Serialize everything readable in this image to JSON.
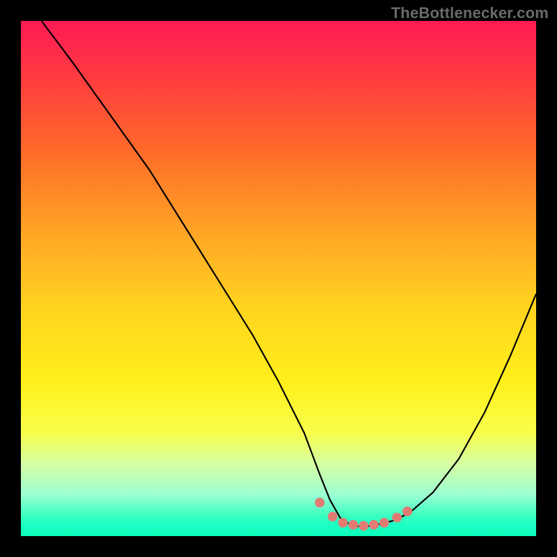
{
  "watermark": "TheBottlenecker.com",
  "colors": {
    "frame": "#000000",
    "curve_stroke": "#000000",
    "marker_fill": "#e27b74",
    "gradient_top": "#ff1a55",
    "gradient_bottom": "#0cffb9"
  },
  "chart_data": {
    "type": "line",
    "title": "",
    "xlabel": "",
    "ylabel": "",
    "xlim": [
      0,
      100
    ],
    "ylim": [
      0,
      100
    ],
    "grid": false,
    "legend": false,
    "series": [
      {
        "name": "bottleneck-curve",
        "x": [
          4,
          10,
          15,
          20,
          25,
          30,
          35,
          40,
          45,
          50,
          55,
          58,
          60,
          62,
          64,
          66,
          68,
          70,
          73,
          76,
          80,
          85,
          90,
          95,
          100
        ],
        "y": [
          100,
          92,
          85,
          78,
          71,
          63,
          55,
          47,
          39,
          30,
          20,
          12,
          7,
          3.5,
          2.2,
          1.8,
          2,
          2.4,
          3.2,
          5,
          8.5,
          15,
          24,
          35,
          47
        ]
      }
    ],
    "markers": [
      {
        "x": 58,
        "y": 6.5
      },
      {
        "x": 60.5,
        "y": 3.8
      },
      {
        "x": 62.5,
        "y": 2.6
      },
      {
        "x": 64.5,
        "y": 2.2
      },
      {
        "x": 66.5,
        "y": 2.0
      },
      {
        "x": 68.5,
        "y": 2.2
      },
      {
        "x": 70.5,
        "y": 2.6
      },
      {
        "x": 73,
        "y": 3.6
      },
      {
        "x": 75,
        "y": 4.8
      }
    ]
  }
}
